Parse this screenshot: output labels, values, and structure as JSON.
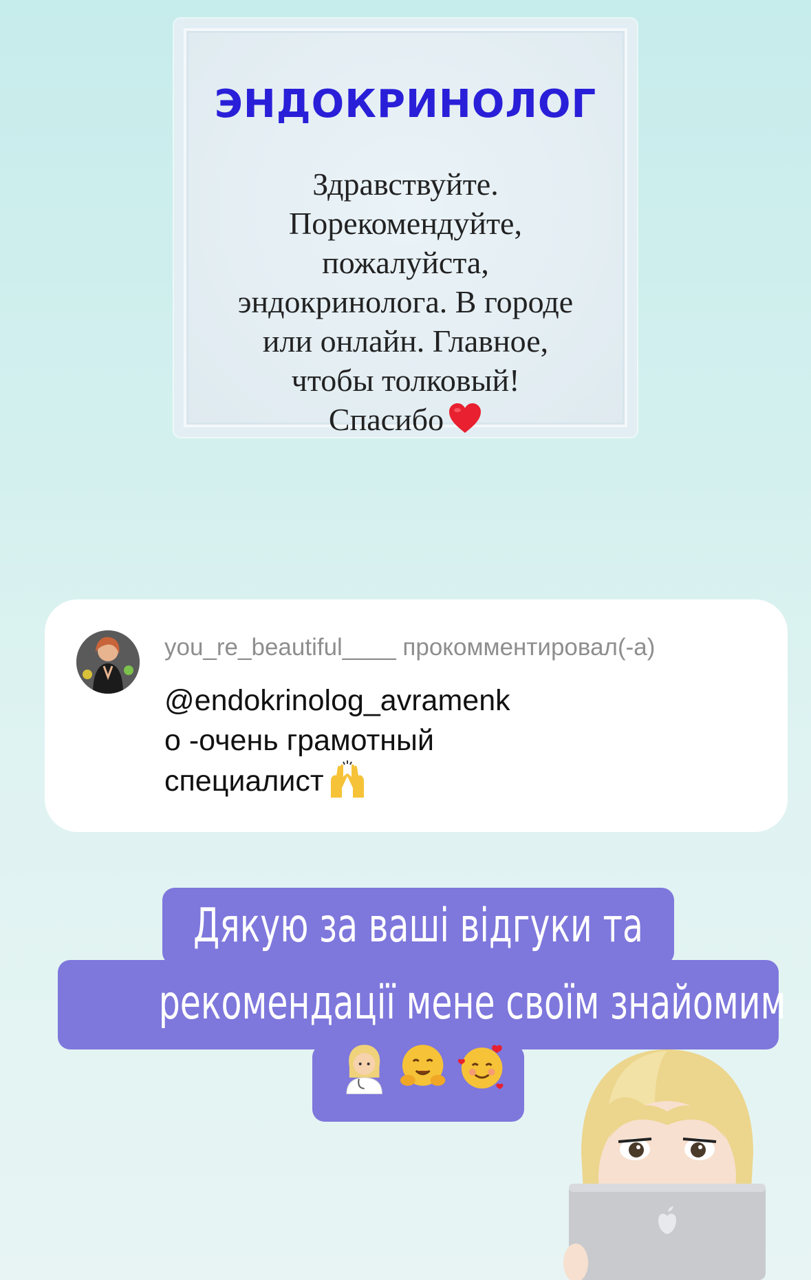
{
  "question": {
    "title": "ЭНДОКРИНОЛОГ",
    "lines": [
      "Здравствуйте.",
      "Порекомендуйте,",
      "пожалуйста,",
      "эндокринолога. В городе",
      "или онлайн. Главное,",
      "чтобы толковый!",
      "Спасибо"
    ],
    "end_emoji": "heart-icon"
  },
  "comment": {
    "username": "you_re_beautiful____",
    "action": "прокомментировал(-а)",
    "lines": [
      "@endokrinolog_avramenk",
      "о -очень грамотный",
      "специалист"
    ],
    "end_emoji": "raised-hands-icon"
  },
  "reply": {
    "lines": [
      "Дякую за ваші відгуки та",
      "рекомендації мене своїм знайомим"
    ],
    "emojis": [
      "doctor-woman-icon",
      "hugging-face-icon",
      "smiling-face-hearts-icon"
    ],
    "highlight_color": "#7e77dc"
  }
}
